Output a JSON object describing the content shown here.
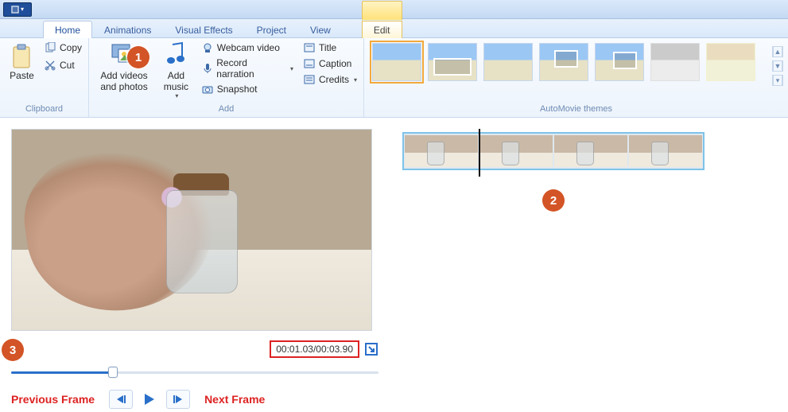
{
  "tabs": {
    "home": "Home",
    "animations": "Animations",
    "visual_effects": "Visual Effects",
    "project": "Project",
    "view": "View",
    "context_group": "",
    "edit": "Edit"
  },
  "ribbon": {
    "clipboard": {
      "label": "Clipboard",
      "paste": "Paste",
      "copy": "Copy",
      "cut": "Cut"
    },
    "add": {
      "label": "Add",
      "add_videos_photos": "Add videos\nand photos",
      "add_music": "Add\nmusic",
      "webcam": "Webcam video",
      "record_narration": "Record narration",
      "snapshot": "Snapshot",
      "title": "Title",
      "caption": "Caption",
      "credits": "Credits"
    },
    "automovie": {
      "label": "AutoMovie themes"
    }
  },
  "player": {
    "timecode": "00:01.03/00:03.90",
    "previous_frame": "Previous Frame",
    "next_frame": "Next Frame"
  },
  "annotations": {
    "b1": "1",
    "b2": "2",
    "b3": "3"
  }
}
